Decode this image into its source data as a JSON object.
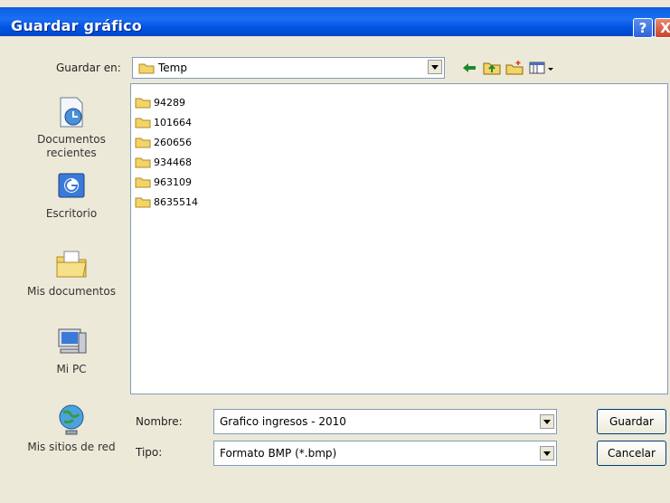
{
  "window": {
    "title": "Guardar gráfico",
    "help_glyph": "?",
    "close_glyph": "X"
  },
  "location": {
    "label": "Guardar en:",
    "value": "Temp"
  },
  "toolbar_icons": [
    "back-icon",
    "up-folder-icon",
    "new-folder-icon",
    "view-menu-icon"
  ],
  "places": [
    {
      "label": "Documentos recientes",
      "icon": "recent-documents-icon"
    },
    {
      "label": "Escritorio",
      "icon": "desktop-icon"
    },
    {
      "label": "Mis documentos",
      "icon": "my-documents-icon"
    },
    {
      "label": "Mi PC",
      "icon": "my-computer-icon"
    },
    {
      "label": "Mis sitios de red",
      "icon": "network-places-icon"
    }
  ],
  "files": [
    {
      "name": "94289"
    },
    {
      "name": "101664"
    },
    {
      "name": "260656"
    },
    {
      "name": "934468"
    },
    {
      "name": "963109"
    },
    {
      "name": "8635514"
    }
  ],
  "filename": {
    "label": "Nombre:",
    "value": "Grafico ingresos - 2010"
  },
  "filetype": {
    "label": "Tipo:",
    "value": "Formato BMP (*.bmp)"
  },
  "buttons": {
    "save": "Guardar",
    "cancel": "Cancelar"
  },
  "colors": {
    "titlebar": "#0054e3",
    "window_bg": "#ece9d8",
    "folder": "#f3d46a"
  }
}
